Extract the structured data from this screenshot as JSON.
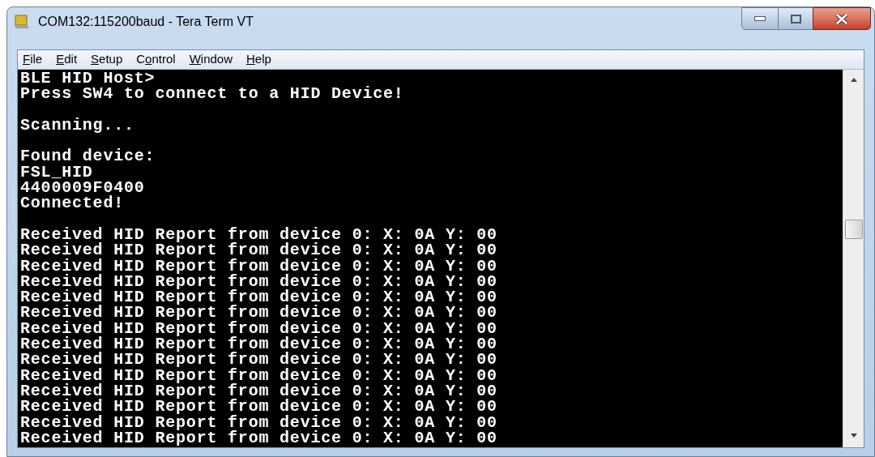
{
  "window": {
    "title": "COM132:115200baud - Tera Term VT"
  },
  "menu": [
    {
      "key": "F",
      "after": "ile"
    },
    {
      "key": "E",
      "after": "dit"
    },
    {
      "key": "S",
      "after": "etup"
    },
    {
      "before": "C",
      "key": "o",
      "after": "ntrol"
    },
    {
      "key": "W",
      "after": "indow"
    },
    {
      "key": "H",
      "after": "elp"
    }
  ],
  "terminal": {
    "blocks": [
      [
        "BLE HID Host>",
        "Press SW4 to connect to a HID Device!"
      ],
      [
        "Scanning..."
      ],
      [
        "Found device:",
        "FSL_HID",
        "4400009F0400",
        "Connected!"
      ],
      [
        "Received HID Report from device 0: X: 0A Y: 00",
        "Received HID Report from device 0: X: 0A Y: 00",
        "Received HID Report from device 0: X: 0A Y: 00",
        "Received HID Report from device 0: X: 0A Y: 00",
        "Received HID Report from device 0: X: 0A Y: 00",
        "Received HID Report from device 0: X: 0A Y: 00",
        "Received HID Report from device 0: X: 0A Y: 00",
        "Received HID Report from device 0: X: 0A Y: 00",
        "Received HID Report from device 0: X: 0A Y: 00",
        "Received HID Report from device 0: X: 0A Y: 00",
        "Received HID Report from device 0: X: 0A Y: 00",
        "Received HID Report from device 0: X: 0A Y: 00",
        "Received HID Report from device 0: X: 0A Y: 00",
        "Received HID Report from device 0: X: 0A Y: 00"
      ]
    ]
  }
}
